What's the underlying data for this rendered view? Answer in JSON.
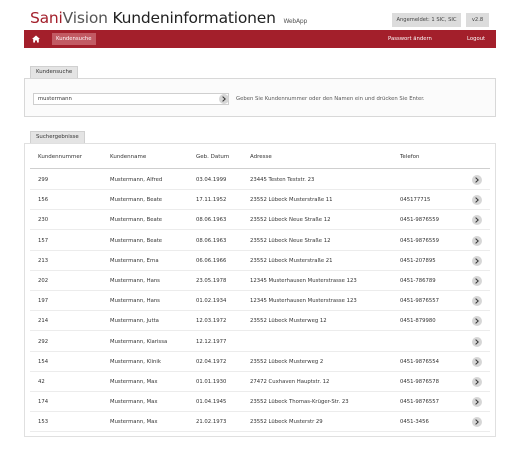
{
  "app": {
    "brand_sani": "Sani",
    "brand_vision": "Vision",
    "title": "Kundeninformationen",
    "subtitle": "WebApp",
    "user_status": "Angemeldet: 1 SIC, SIC",
    "version": "v2.8"
  },
  "nav": {
    "home_icon": "home-icon",
    "active_tab": "Kundensuche",
    "change_password": "Passwort ändern",
    "logout": "Logout"
  },
  "search": {
    "tab_label": "Kundensuche",
    "value": "mustermann",
    "button_icon": "chevron-right-icon",
    "hint": "Geben Sie Kundennummer oder den Namen ein und drücken Sie Enter."
  },
  "results": {
    "tab_label": "Suchergebnisse",
    "columns": [
      "Kundennummer",
      "Kundenname",
      "Geb. Datum",
      "Adresse",
      "Telefon"
    ],
    "rows": [
      {
        "nr": "299",
        "name": "Mustermann, Alfred",
        "dob": "03.04.1999",
        "address": "23445 Testen Teststr. 23",
        "phone": ""
      },
      {
        "nr": "156",
        "name": "Mustermann, Beate",
        "dob": "17.11.1952",
        "address": "23552 Lübeck Musterstraße 11",
        "phone": "045177715"
      },
      {
        "nr": "230",
        "name": "Mustermann, Beate",
        "dob": "08.06.1963",
        "address": "23552 Lübeck Neue Straße 12",
        "phone": "0451-9876559"
      },
      {
        "nr": "157",
        "name": "Mustermann, Beate",
        "dob": "08.06.1963",
        "address": "23552 Lübeck Neue Straße 12",
        "phone": "0451-9876559"
      },
      {
        "nr": "213",
        "name": "Mustermann, Erna",
        "dob": "06.06.1966",
        "address": "23552 Lübeck Musterstraße 21",
        "phone": "0451-207895"
      },
      {
        "nr": "202",
        "name": "Mustermann, Hans",
        "dob": "23.05.1978",
        "address": "12345 Musterhausen Musterstrasse 123",
        "phone": "0451-786789"
      },
      {
        "nr": "197",
        "name": "Mustermann, Hans",
        "dob": "01.02.1934",
        "address": "12345 Musterhausen Musterstrasse 123",
        "phone": "0451-9876557"
      },
      {
        "nr": "214",
        "name": "Mustermann, Jutta",
        "dob": "12.03.1972",
        "address": "23552 Lübeck Musterweg 12",
        "phone": "0451-879980"
      },
      {
        "nr": "292",
        "name": "Mustermann, Klarissa",
        "dob": "12.12.1977",
        "address": "",
        "phone": ""
      },
      {
        "nr": "154",
        "name": "Mustermann, Klinik",
        "dob": "02.04.1972",
        "address": "23552 Lübeck Musterweg 2",
        "phone": "0451-9876554"
      },
      {
        "nr": "42",
        "name": "Mustermann, Max",
        "dob": "01.01.1930",
        "address": "27472 Cuxhaven Hauptstr. 12",
        "phone": "0451-9876578"
      },
      {
        "nr": "174",
        "name": "Mustermann, Max",
        "dob": "01.04.1945",
        "address": "23552 Lübeck Thomas-Krüger-Str. 23",
        "phone": "0451-9876557"
      },
      {
        "nr": "153",
        "name": "Mustermann, Max",
        "dob": "21.02.1973",
        "address": "23552 Lübeck Musterstr 29",
        "phone": "0451-3456"
      }
    ],
    "row_button_icon": "chevron-right-icon"
  },
  "colors": {
    "brand_red": "#a31f2b",
    "active_tab": "#c25a63",
    "button_gray": "#d6d6d6"
  }
}
